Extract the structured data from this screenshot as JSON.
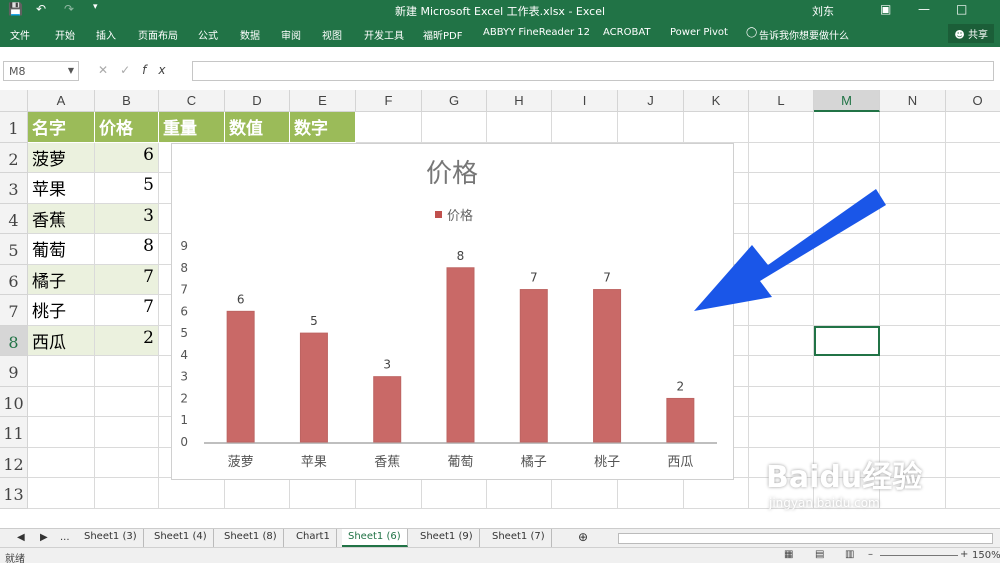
{
  "titlebar": {
    "title": "新建 Microsoft Excel 工作表.xlsx  -  Excel",
    "user": "刘东"
  },
  "ribbon": {
    "tabs": [
      "文件",
      "开始",
      "插入",
      "页面布局",
      "公式",
      "数据",
      "审阅",
      "视图",
      "开发工具",
      "福昕PDF",
      "ABBYY FineReader 12",
      "ACROBAT",
      "Power Pivot",
      "告诉我你想要做什么"
    ],
    "share_label": "共享"
  },
  "formula_bar": {
    "name_box": "M8",
    "fx_label": "fx",
    "value": ""
  },
  "columns": [
    "A",
    "B",
    "C",
    "D",
    "E",
    "F",
    "G",
    "H",
    "I",
    "J",
    "K",
    "L",
    "M",
    "N",
    "O"
  ],
  "rows": [
    "1",
    "2",
    "3",
    "4",
    "5",
    "6",
    "7",
    "8",
    "9",
    "10",
    "11",
    "12",
    "13"
  ],
  "table": {
    "headers": [
      "名字",
      "价格",
      "重量",
      "数值",
      "数字"
    ],
    "items": [
      {
        "name": "菠萝",
        "price": "6"
      },
      {
        "name": "苹果",
        "price": "5"
      },
      {
        "name": "香蕉",
        "price": "3"
      },
      {
        "name": "葡萄",
        "price": "8"
      },
      {
        "name": "橘子",
        "price": "7"
      },
      {
        "name": "桃子",
        "price": "7"
      },
      {
        "name": "西瓜",
        "price": "2"
      }
    ]
  },
  "chart_data": {
    "type": "bar",
    "title": "价格",
    "categories": [
      "菠萝",
      "苹果",
      "香蕉",
      "葡萄",
      "橘子",
      "桃子",
      "西瓜"
    ],
    "series": [
      {
        "name": "价格",
        "values": [
          6,
          5,
          3,
          8,
          7,
          7,
          2
        ]
      }
    ],
    "ylim": [
      0,
      9
    ],
    "yticks": [
      "0",
      "1",
      "2",
      "3",
      "4",
      "5",
      "6",
      "7",
      "8",
      "9"
    ],
    "legend": "top",
    "bar_color": "#c0504d",
    "grid": false
  },
  "sheet_tabs": [
    "Sheet1 (3)",
    "Sheet1 (4)",
    "Sheet1 (8)",
    "Chart1",
    "Sheet1 (6)",
    "Sheet1 (9)",
    "Sheet1 (7)"
  ],
  "active_sheet": "Sheet1 (6)",
  "status": {
    "mode": "就绪",
    "zoom": "150%"
  },
  "watermark": {
    "text": "Baidu经验",
    "url": "jingyan.baidu.com"
  },
  "colors": {
    "excel_green": "#217346",
    "header_fill": "#9bbb59",
    "band_fill": "#ebf1de",
    "arrow": "#1a56e8"
  }
}
